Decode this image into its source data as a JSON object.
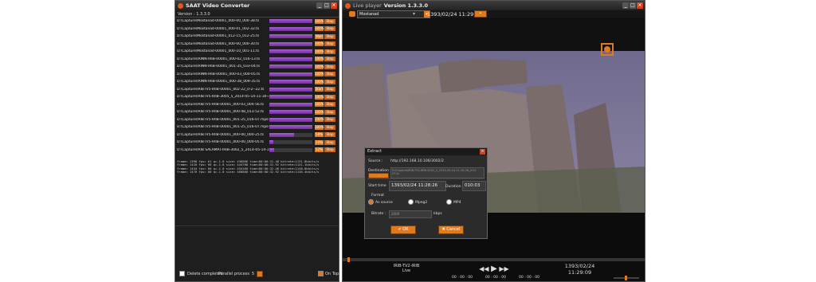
{
  "converter": {
    "title": "SAAT Video Converter",
    "version": "Version : 1.3.3.0",
    "jobs": [
      {
        "path": "D:\\Capture\\Mostanad-00001_000-00_000-38.ts",
        "progress": 100,
        "pct": "100%",
        "action": "Stop"
      },
      {
        "path": "D:\\Capture\\Mostanad-00001_000-01_002-32.ts",
        "progress": 100,
        "pct": "100%",
        "action": "Stop"
      },
      {
        "path": "D:\\Capture\\Mostanad-00001_012-15_012-25.ts",
        "progress": 100,
        "pct": "Wait",
        "action": "Stop"
      },
      {
        "path": "D:\\Capture\\Mostanad-00001_000-00_000-30.ts",
        "progress": 100,
        "pct": "100%",
        "action": "Stop"
      },
      {
        "path": "D:\\Capture\\Mostanad-00001_000-10_001-11.ts",
        "progress": 100,
        "pct": "100%",
        "action": "Stop"
      },
      {
        "path": "D:\\Capture\\IRINN-IRIB-00001_000-02_016-13.ts",
        "progress": 100,
        "pct": "100%",
        "action": "Stop"
      },
      {
        "path": "D:\\Capture\\IRINN-IRIB-00001_001-35_033-04.ts",
        "progress": 100,
        "pct": "100%",
        "action": "Stop"
      },
      {
        "path": "D:\\Capture\\IRINN-IRIB-00001_000-03_000-05.ts",
        "progress": 100,
        "pct": "100%",
        "action": "Stop"
      },
      {
        "path": "D:\\Capture\\IRINN-IRIB-00001_000-38_009-35.ts",
        "progress": 100,
        "pct": "100%",
        "action": "Stop"
      },
      {
        "path": "D:\\Capture\\IRIBTV5-IRIB-00001_002-22_0-2--22.ts",
        "progress": 100,
        "pct": "Start",
        "action": "Stop"
      },
      {
        "path": "D:\\Capture\\IRIBTV5-IRIB-3005_5_2014-05-14-11-30-48",
        "progress": 100,
        "pct": "100%",
        "action": "Stop"
      },
      {
        "path": "D:\\Capture\\IRIBTV5-IRIB-00001_000-03_004-56.ts",
        "progress": 100,
        "pct": "100%",
        "action": "Stop"
      },
      {
        "path": "D:\\Capture\\IRIBTV5-IRIB-00001_000-48_013-52.ts",
        "progress": 100,
        "pct": "100%",
        "action": "Stop"
      },
      {
        "path": "D:\\Capture\\IRIBTV5-IRIB-00001_001-25_016-07.mpeg",
        "progress": 100,
        "pct": "100%",
        "action": "Stop"
      },
      {
        "path": "D:\\Capture\\IRIBTV5-IRIB-00001_001-25_016-07.mpeg",
        "progress": 100,
        "pct": "100%",
        "action": "Stop"
      },
      {
        "path": "D:\\Capture\\IRIBTV5-IRIB-00001_000-00_000-25.ts",
        "progress": 58,
        "pct": "58%",
        "action": "Stop"
      },
      {
        "path": "D:\\Capture\\IRIBTV5-IRIB-00001_000-00_000-05.ts",
        "progress": 10,
        "pct": "10%",
        "action": "Stop"
      },
      {
        "path": "D:\\Capture\\IRIB SALAMAT-IRIB-3002_5_2014-05-14-11-",
        "progress": 12,
        "pct": "12%",
        "action": "Stop"
      }
    ],
    "log": [
      "frame= 1398 fps= 61 q=-1.0 size=   436866 time=00:00:31.48 bitrate=1131.8kbits/s",
      "frame= 1420 fps= 60 q=-1.0 size=   444768 time=00:00:31.92 bitrate=1141.1kbits/s",
      "frame= 1444 fps= 60 q=-1.0 size=   454160 time=00:00:32.40 bitrate=1148.0kbits/s",
      "frame= 1470 fps= 60 q=-1.0 size=   460860 time=00:00:32.92 bitrate=1146.4kbits/s"
    ],
    "footer": {
      "delete_label": "Delete completed",
      "parallel_label": "Parallel process",
      "parallel_value": "5",
      "ontop_label": "On Top"
    }
  },
  "player": {
    "title": "Version 1.3.3.0",
    "title_prefix": "Live player",
    "channel": "Mostanad",
    "datetime": "1393/02/24  11:29:22",
    "channel_name": "IRIB-TV2-IRIB",
    "mode": "Live",
    "timeline_date": "1393/02/24",
    "timeline_time": "11:29:09",
    "time_left": "00 : 00 : 00",
    "time_mid": "00 : 00 : 00",
    "time_right": "00 : 00 : 00"
  },
  "extract": {
    "title": "Extract",
    "source_label": "Source :",
    "source_value": "http://192.168.10.106/3002/2",
    "destination_label": "Destination :",
    "destination_value": "D:\\Capture\\IRIB-TV2-IRIB-3002_2_2014-05-14-11-28-26_010-03.ts",
    "start_label": "Start time",
    "start_value": "1393/02/24  11:28:26",
    "duration_label": "Duration",
    "duration_value": "010:03",
    "format_label": "Format",
    "formats": [
      "As source",
      "Mpeg2",
      "MP4"
    ],
    "selected_format": "As source",
    "bitrate_label": "Bitrate :",
    "bitrate_value": "2000",
    "bitrate_unit": "kbps",
    "ok_label": "OK",
    "cancel_label": "Cancel"
  },
  "colors": {
    "accent": "#e07a1c",
    "progress": "#8a3fbf",
    "window_bg": "#1e1e1e"
  }
}
